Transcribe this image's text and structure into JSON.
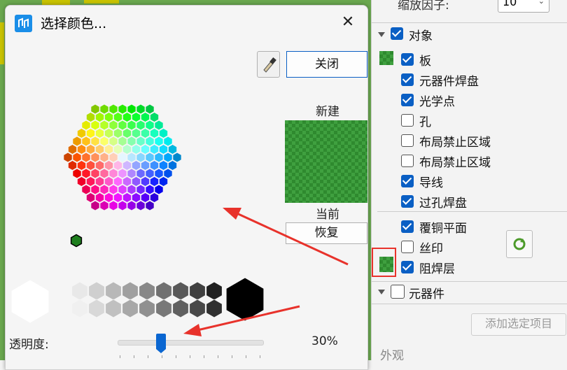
{
  "dialog": {
    "title": "选择颜色...",
    "close_glyph": "✕"
  },
  "buttons": {
    "close_label": "关闭",
    "restore_label": "恢复"
  },
  "labels": {
    "new": "新建",
    "current": "当前",
    "transparency": "透明度:",
    "transparency_value": "30%"
  },
  "transparency_percent": 30,
  "colors": {
    "new_swatch": "#3fa03f",
    "accent": "#0a5fc4",
    "annotation": "#e8322b"
  },
  "panel": {
    "zoom_label": "缩放因子:",
    "zoom_value": "10",
    "objects_header": "对象",
    "items": [
      {
        "label": "板",
        "checked": true
      },
      {
        "label": "元器件焊盘",
        "checked": true
      },
      {
        "label": "光学点",
        "checked": true
      },
      {
        "label": "孔",
        "checked": false
      },
      {
        "label": "布局禁止区域",
        "checked": false
      },
      {
        "label": "布局禁止区域",
        "checked": false
      },
      {
        "label": "导线",
        "checked": true
      },
      {
        "label": "过孔焊盘",
        "checked": true
      }
    ],
    "layers": [
      {
        "label": "覆铜平面",
        "checked": true
      },
      {
        "label": "丝印",
        "checked": false
      },
      {
        "label": "阻焊层",
        "checked": true
      }
    ],
    "components_header": "元器件",
    "add_selected_label": "添加选定项目",
    "appearance_label": "外观"
  },
  "icons": {
    "app": "color-picker-app-icon",
    "eyedropper": "eyedropper-icon",
    "refresh": "refresh-icon"
  }
}
